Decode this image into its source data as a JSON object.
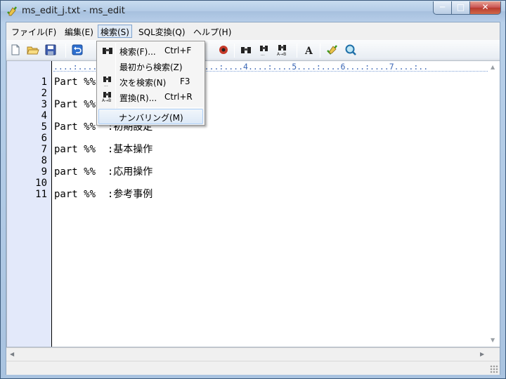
{
  "window": {
    "title": "ms_edit_j.txt - ms_edit",
    "minimize": "─",
    "maximize": "□",
    "close": "✕"
  },
  "menubar": [
    {
      "label": "ファイル(F)"
    },
    {
      "label": "編集(E)"
    },
    {
      "label": "検索(S)"
    },
    {
      "label": "SQL変換(Q)"
    },
    {
      "label": "ヘルプ(H)"
    }
  ],
  "toolbar_icons": [
    "new-file-icon",
    "open-folder-icon",
    "save-icon",
    "undo-icon",
    "binoculars-icon",
    "find-next-icon",
    "replace-icon",
    "font-icon",
    "check-pencil-icon",
    "zoom-icon"
  ],
  "ruler": "....:....1....:....2....:....3....:....4....:....5....:....6....:....7....:..",
  "gutter": [
    "1",
    "2",
    "3",
    "4",
    "5",
    "6",
    "7",
    "8",
    "9",
    "10",
    "11"
  ],
  "lines": [
    "Part %%  :概要",
    "",
    "Part %%  :インストール",
    "",
    "Part %%  :初期設定",
    "",
    "part %%  :基本操作",
    "",
    "part %%  :応用操作",
    "",
    "part %%  :参考事例"
  ],
  "search_menu": {
    "items": [
      {
        "label": "検索(F)...",
        "shortcut": "Ctrl+F",
        "icon": "binoculars-icon"
      },
      {
        "label": "最初から検索(Z)",
        "shortcut": "",
        "icon": ""
      },
      {
        "label": "次を検索(N)",
        "shortcut": "F3",
        "icon": "find-next-icon"
      },
      {
        "label": "置換(R)...",
        "shortcut": "Ctrl+R",
        "icon": "replace-icon"
      }
    ],
    "numbering": "ナンバリング(M)"
  },
  "scroll": {
    "up": "▲",
    "down": "▼",
    "left": "◀",
    "right": "▶"
  },
  "colors": {
    "gutter_bg": "#e3e9fa",
    "ruler": "#3a66b5",
    "menu_highlight": "#dce9f7"
  }
}
